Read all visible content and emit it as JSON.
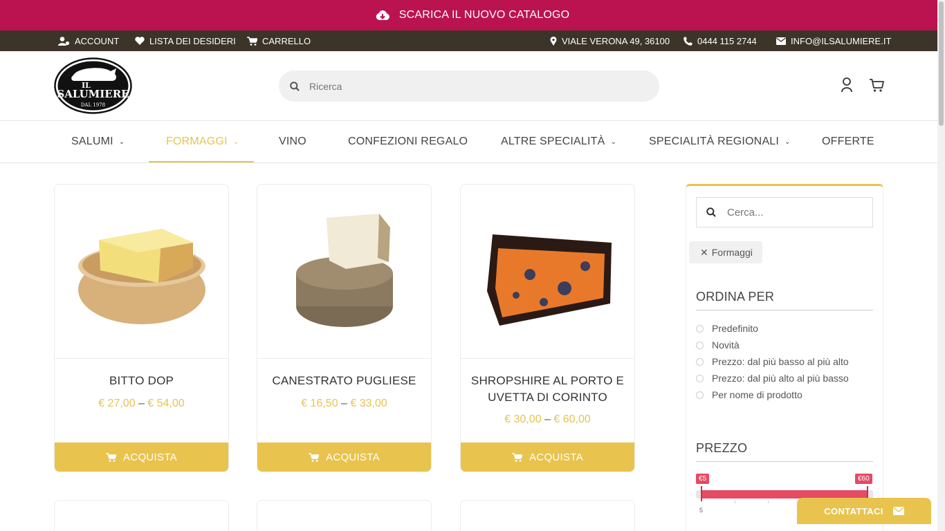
{
  "promo": {
    "text": "SCARICA IL NUOVO CATALOGO",
    "icon": "cloud-download-icon"
  },
  "topbar": {
    "account": "ACCOUNT",
    "wishlist": "LISTA DEI DESIDERI",
    "cart": "CARRELLO",
    "address": "VIALE VERONA 49, 36100",
    "phone": "0444 115 2744",
    "email": "INFO@ILSALUMIERE.IT"
  },
  "logo": {
    "line1": "IL",
    "line2": "SALUMIERE",
    "line3": "DAL 1978"
  },
  "search": {
    "placeholder": "Ricerca"
  },
  "nav": {
    "items": [
      {
        "label": "SALUMI"
      },
      {
        "label": "FORMAGGI"
      },
      {
        "label": "VINO"
      },
      {
        "label": "CONFEZIONI REGALO"
      },
      {
        "label": "ALTRE SPECIALITÀ"
      },
      {
        "label": "SPECIALITÀ REGIONALI"
      },
      {
        "label": "OFFERTE"
      }
    ],
    "active": "FORMAGGI"
  },
  "products": [
    {
      "title": "BITTO DOP",
      "price_min": "€ 27,00",
      "price_max": "€ 54,00",
      "buy_label": "ACQUISTA"
    },
    {
      "title": "CANESTRATO PUGLIESE",
      "price_min": "€ 16,50",
      "price_max": "€ 33,00",
      "buy_label": "ACQUISTA"
    },
    {
      "title": "SHROPSHIRE AL PORTO E UVETTA DI CORINTO",
      "price_min": "€ 30,00",
      "price_max": "€ 60,00",
      "buy_label": "ACQUISTA"
    }
  ],
  "price_separator": "–",
  "sidebar": {
    "search_placeholder": "Cerca...",
    "active_filter": "Formaggi",
    "sort_heading": "ORDINA PER",
    "sort_options": [
      "Predefinito",
      "Novità",
      "Prezzo: dal più basso al più alto",
      "Prezzo: dal più alto al più basso",
      "Per nome di prodotto"
    ],
    "price_heading": "PREZZO",
    "price_min_label": "€5",
    "price_max_label": "€60",
    "price_scale_min": "5"
  },
  "contact": {
    "label": "CONTATTACI"
  },
  "colors": {
    "promo": "#bb134f",
    "topbar": "#3c3429",
    "accent": "#e8c34d",
    "slider": "#e54b63"
  }
}
